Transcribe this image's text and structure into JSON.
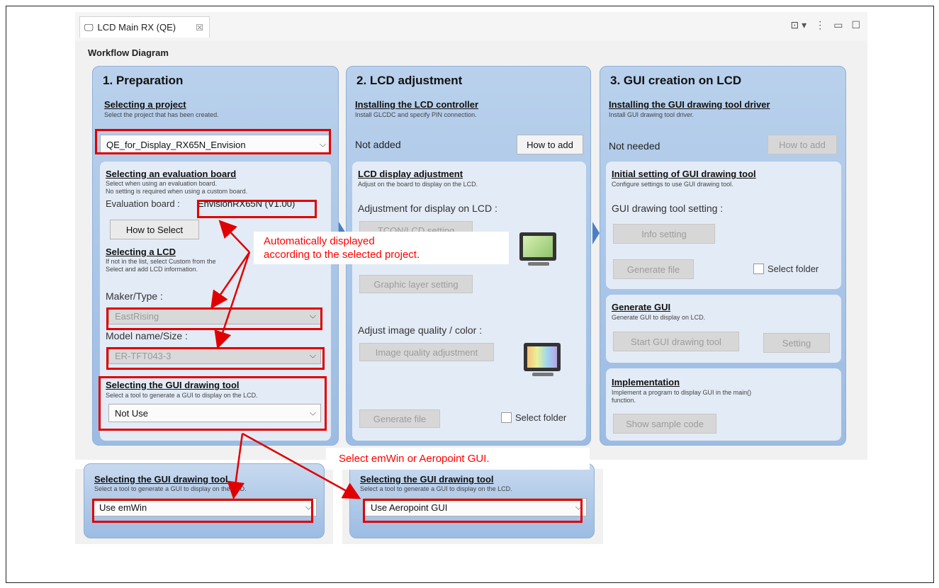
{
  "window": {
    "tab_title": "LCD Main RX (QE)",
    "tab_close": "☒"
  },
  "workflow_title": "Workflow Diagram",
  "col1": {
    "title": "1. Preparation",
    "project": {
      "title": "Selecting a project",
      "desc": "Select the project that has been created.",
      "value": "QE_for_Display_RX65N_Envision"
    },
    "board": {
      "title": "Selecting an evaluation board",
      "desc1": "Select when using an evaluation board.",
      "desc2": "No setting is required when using a custom board.",
      "label": "Evaluation board :",
      "value": "EnvisionRX65N (V1.00)",
      "button": "How to Select"
    },
    "lcd": {
      "title": "Selecting a LCD",
      "desc1": "If not in the list, select Custom from the",
      "desc2": "Select and add LCD information.",
      "maker_label": "Maker/Type :",
      "maker_value": "EastRising",
      "model_label": "Model name/Size :",
      "model_value": "ER-TFT043-3"
    },
    "gui": {
      "title": "Selecting the GUI drawing tool",
      "desc": "Select a tool to generate a GUI to display on the LCD.",
      "value": "Not Use"
    }
  },
  "col2": {
    "title": "2. LCD adjustment",
    "controller": {
      "title": "Installing the LCD controller",
      "desc": "Install GLCDC and specify PIN connection.",
      "status": "Not added",
      "button": "How to add"
    },
    "display": {
      "title": "LCD display adjustment",
      "desc": "Adjust on the board to display on the LCD.",
      "label1": "Adjustment for display on LCD :",
      "btn_tcon": "TCON/LCD setting",
      "btn_graphic": "Graphic layer setting",
      "label2": "Adjust image quality / color :",
      "btn_quality": "Image quality adjustment",
      "btn_generate": "Generate file",
      "chk_folder": "Select folder"
    }
  },
  "col3": {
    "title": "3. GUI creation on LCD",
    "driver": {
      "title": "Installing the GUI drawing tool driver",
      "desc": "Install GUI drawing tool driver.",
      "status": "Not needed",
      "button": "How to add"
    },
    "initial": {
      "title": "Initial setting of GUI drawing tool",
      "desc": "Configure settings to use GUI drawing tool.",
      "label": "GUI drawing tool setting :",
      "btn_info": "Info setting",
      "btn_generate": "Generate file",
      "chk_folder": "Select folder"
    },
    "generate": {
      "title": "Generate GUI",
      "desc": "Generate GUI to display on LCD.",
      "btn_start": "Start GUI drawing tool",
      "btn_setting": "Setting"
    },
    "impl": {
      "title": "Implementation",
      "desc1": "Implement a program to display GUI in the main()",
      "desc2": "function.",
      "btn_sample": "Show sample code"
    }
  },
  "callouts": {
    "auto_line1": "Automatically displayed",
    "auto_line2": "according to the selected project.",
    "select": "Select emWin or Aeropoint GUI."
  },
  "bottom": {
    "left": {
      "title": "Selecting the GUI drawing tool",
      "desc": "Select a tool to generate a GUI to display on the LCD.",
      "value": "Use emWin"
    },
    "right": {
      "title": "Selecting the GUI drawing tool",
      "desc": "Select a tool to generate a GUI to display on the LCD.",
      "value": "Use Aeropoint GUI"
    }
  },
  "colors": {
    "highlight": "#e00000",
    "callout_text": "#ff0000",
    "panel_blue": "#9cbce3"
  }
}
